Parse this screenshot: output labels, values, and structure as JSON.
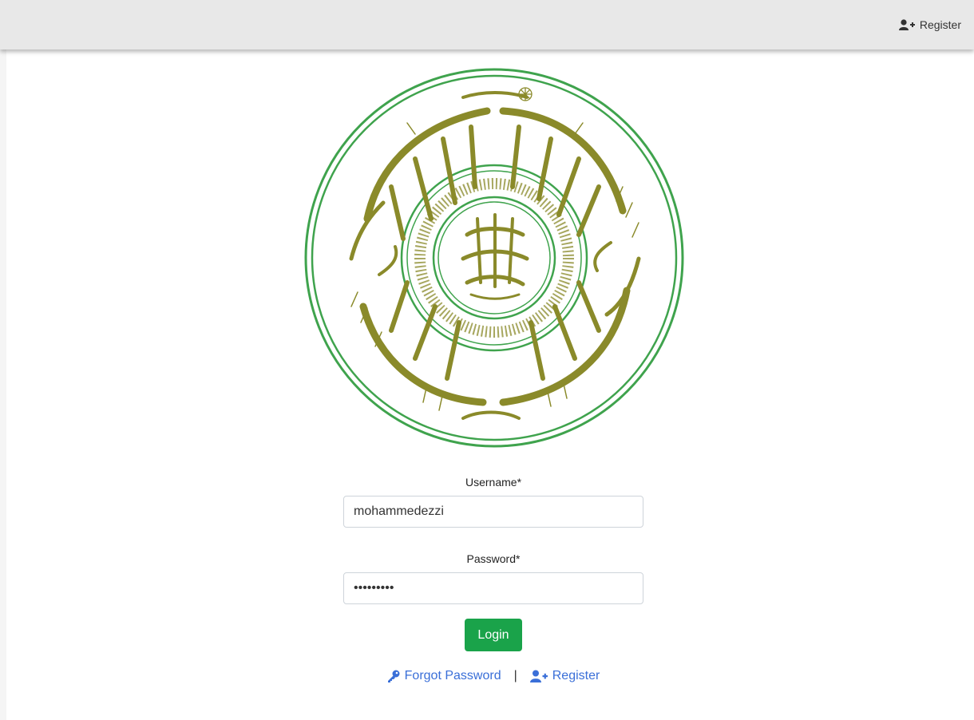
{
  "header": {
    "register_label": "Register",
    "register_icon": "user-plus-icon"
  },
  "form": {
    "username_label": "Username*",
    "username_value": "mohammedezzi",
    "password_label": "Password*",
    "password_value": "•••••••••",
    "login_label": "Login"
  },
  "links": {
    "forgot_label": "Forgot Password",
    "forgot_icon": "key-icon",
    "separator": "|",
    "register_label": "Register",
    "register_icon": "user-plus-icon"
  },
  "colors": {
    "login_button": "#1aa34a",
    "link": "#3a6fd8",
    "seal_green": "#3fa34d",
    "seal_calligraphy": "#8a8a2a"
  }
}
